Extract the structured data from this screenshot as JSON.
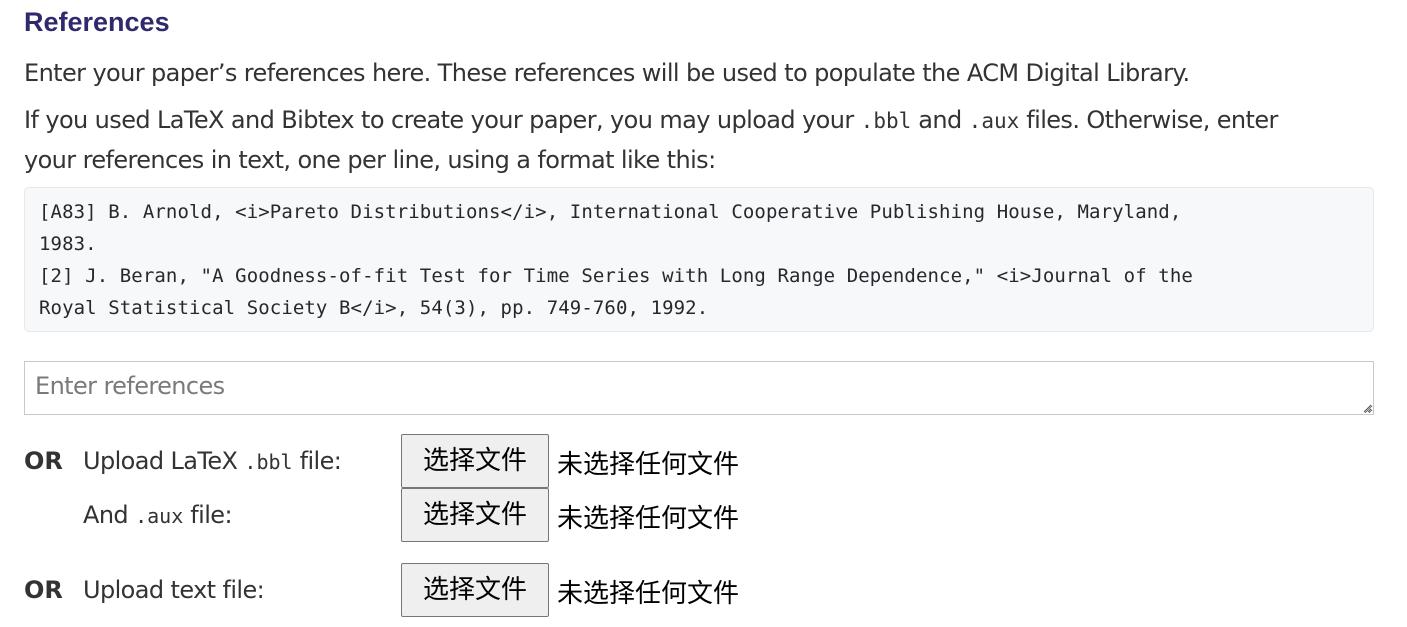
{
  "references": {
    "title": "References",
    "intro": "Enter your paper’s references here. These references will be used to populate the ACM Digital Library.",
    "latex_text_a": "If you used LaTeX and Bibtex to create your paper, you may upload your ",
    "latex_code_bbl": ".bbl",
    "latex_text_b": " and ",
    "latex_code_aux": ".aux",
    "latex_text_c": " files. Otherwise, enter",
    "latex_text_line2": "your references in text, one per line, using a format like this:",
    "example_lines": [
      "[A83] B. Arnold, <i>Pareto Distributions</i>, International Cooperative Publishing House, Maryland,",
      "1983.",
      "[2] J. Beran, \"A Goodness-of-fit Test for Time Series with Long Range Dependence,\" <i>Journal of the",
      "Royal Statistical Society B</i>, 54(3), pp. 749-760, 1992."
    ],
    "textarea_placeholder": "Enter references",
    "or_label": "OR",
    "bbl_label_prefix": "Upload LaTeX ",
    "bbl_label_code": ".bbl",
    "bbl_label_suffix": " file:",
    "aux_label_prefix": "And ",
    "aux_label_code": ".aux",
    "aux_label_suffix": " file:",
    "text_file_label": "Upload text file:",
    "choose_file_button": "选择文件",
    "no_file_chosen": "未选择任何文件"
  }
}
